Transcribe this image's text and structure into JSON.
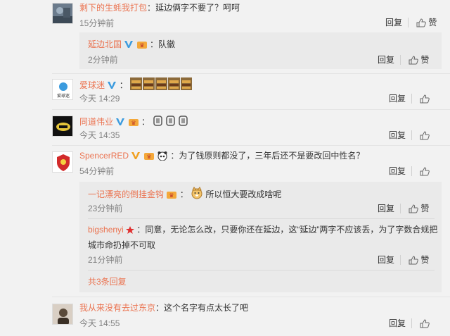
{
  "actions": {
    "reply": "回复",
    "like": "赞"
  },
  "comments": [
    {
      "user": "剩下的生蚝我打包",
      "text": "：延边俩字不要了？呵呵",
      "time": "15分钟前"
    },
    {
      "user": "延边北国",
      "text": "：队徽",
      "time": "2分钟前"
    },
    {
      "user": "爱球迷",
      "text": "：",
      "time": "今天 14:29",
      "avatar_text": "爱球迷"
    },
    {
      "user": "同道伟业",
      "text": "：",
      "time": "今天 14:35"
    },
    {
      "user": "SpencerRED",
      "text": "：为了钱原则都没了，三年后还不是要改回中性名？",
      "time": "54分钟前"
    },
    {
      "user": "一记漂亮的倒挂金钩",
      "text": "所以恒大要改成啥呢",
      "time": "23分钟前"
    },
    {
      "user": "bigshenyi",
      "text_line1": "：同意，无论怎么改，只要你还在延边，这“延边”两字不应该丢，为了字数合规把",
      "text_line2": "城市命扔掉不可取",
      "time": "21分钟前"
    },
    {
      "user": "我从来没有去过东京",
      "text": "：这个名字有点太长了吧",
      "time": "今天 14:55"
    }
  ],
  "more_replies": "共3条回复",
  "colors": {
    "name": "#eb7350",
    "v_badge": "#3b9bde",
    "background": "#f2f2f2",
    "reply_bg": "#eaeaea"
  }
}
